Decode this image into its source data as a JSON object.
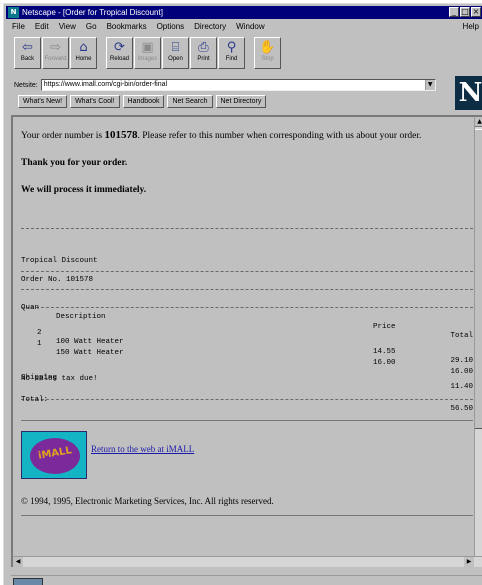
{
  "window": {
    "app_icon": "N",
    "title": "Netscape - [Order for Tropical Discount]",
    "controls": [
      "_",
      "□",
      "×"
    ]
  },
  "menu": {
    "items": [
      "File",
      "Edit",
      "View",
      "Go",
      "Bookmarks",
      "Options",
      "Directory",
      "Window"
    ],
    "help": "Help"
  },
  "toolbar": {
    "buttons": [
      {
        "label": "Back",
        "icon": "back-arrow-icon",
        "glyph": "⇦",
        "enabled": true
      },
      {
        "label": "Forward",
        "icon": "forward-arrow-icon",
        "glyph": "⇨",
        "enabled": false
      },
      {
        "label": "Home",
        "icon": "home-icon",
        "glyph": "⌂",
        "enabled": true
      },
      {
        "label": "Reload",
        "icon": "reload-icon",
        "glyph": "⟳",
        "enabled": true
      },
      {
        "label": "Images",
        "icon": "images-icon",
        "glyph": "▣",
        "enabled": false
      },
      {
        "label": "Open",
        "icon": "open-icon",
        "glyph": "⌸",
        "enabled": true
      },
      {
        "label": "Print",
        "icon": "print-icon",
        "glyph": "⎙",
        "enabled": true
      },
      {
        "label": "Find",
        "icon": "find-icon",
        "glyph": "⚲",
        "enabled": true
      },
      {
        "label": "Stop",
        "icon": "stop-icon",
        "glyph": "✋",
        "enabled": false
      }
    ]
  },
  "location": {
    "label": "Netsite:",
    "url": "https://www.imall.com/cgi-bin/order-final"
  },
  "directory_buttons": [
    "What's New!",
    "What's Cool!",
    "Handbook",
    "Net Search",
    "Net Directory"
  ],
  "brand_logo": "N",
  "page": {
    "order_intro": "Your order number is ",
    "order_number": "101578",
    "order_outro": ". Please refer to this number when corresponding with us about your order.",
    "thanks": "Thank you for your order.",
    "process": "We will process it immediately.",
    "merchant": "Tropical Discount",
    "order_no_line": "Order No. 101578",
    "table_headers": {
      "quan": "Quan",
      "description": "Description",
      "price": "Price",
      "total": "Total"
    },
    "items": [
      {
        "quan": "2",
        "description": "100 Watt Heater",
        "price": "14.55",
        "total": "29.10"
      },
      {
        "quan": "1",
        "description": "150 Watt Heater",
        "price": "16.00",
        "total": "16.00"
      }
    ],
    "shipping_label": "Shipping",
    "shipping_value": "11.40",
    "tax_note": "No sales tax due!",
    "total_label": "Total:",
    "total_value": "56.50",
    "logo_text": "iMALL",
    "return_link": "Return to the web at iMALL",
    "copyright": "© 1994, 1995, Electronic Marketing Services, Inc.  All rights reserved."
  },
  "colors": {
    "title_bar": "#00007b",
    "page_background": "#c0c0c0",
    "link": "#1a1aa8"
  }
}
